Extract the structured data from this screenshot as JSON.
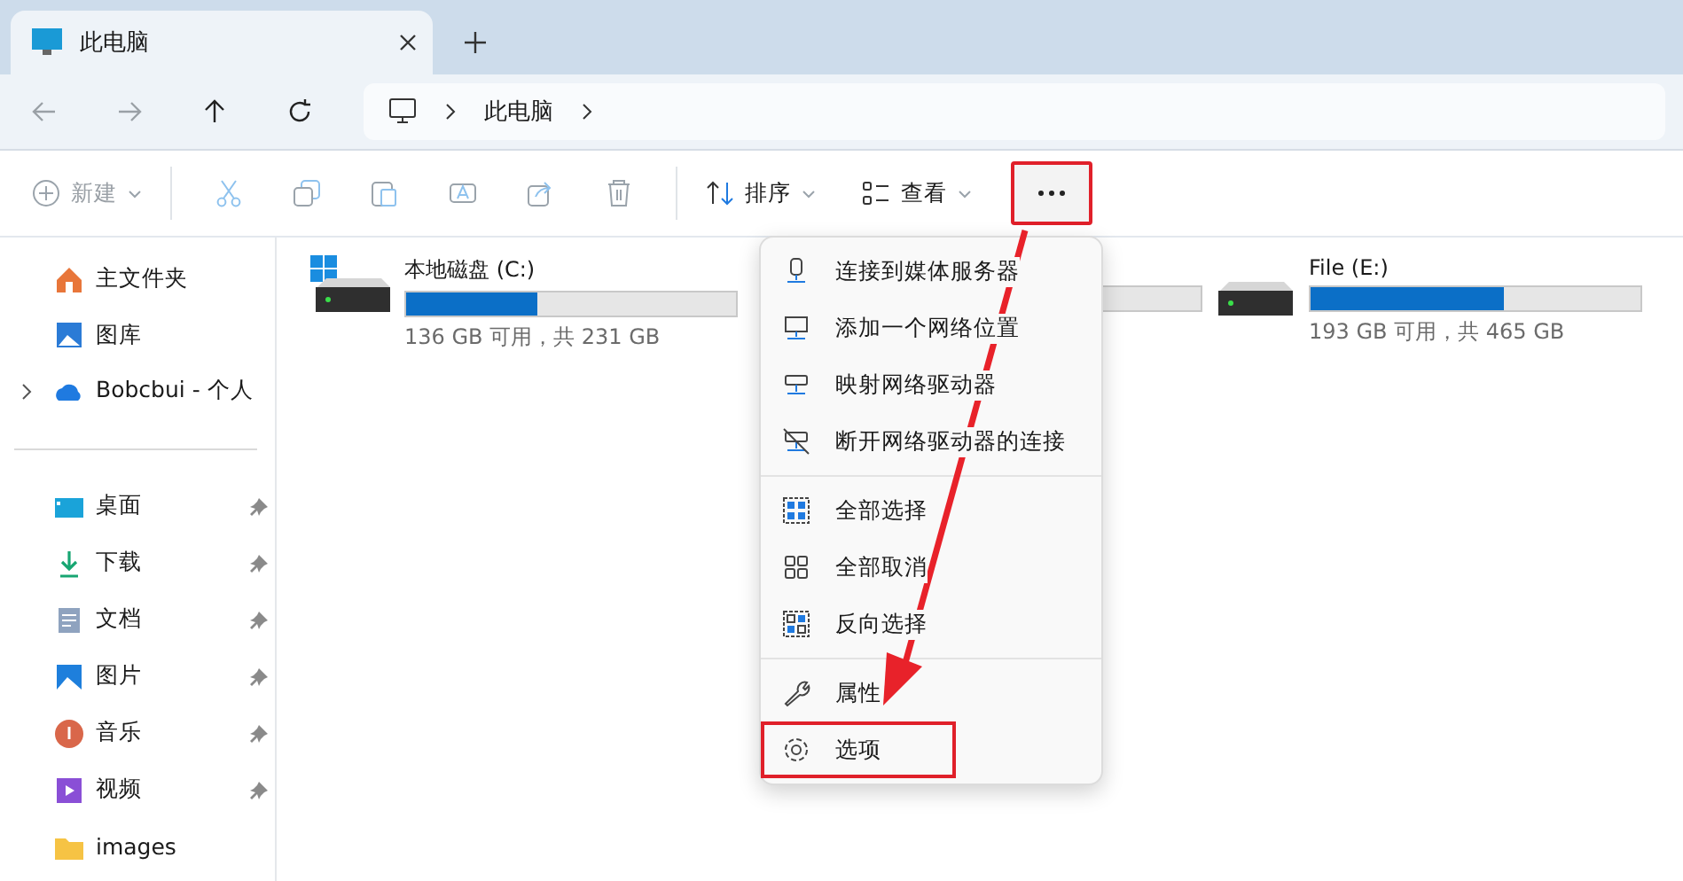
{
  "tab": {
    "title": "此电脑",
    "selected": true
  },
  "breadcrumb": [
    "此电脑"
  ],
  "toolbar": {
    "new_label": "新建",
    "sort_label": "排序",
    "view_label": "查看"
  },
  "sidebar": {
    "top": [
      {
        "label": "主文件夹",
        "expandable": false
      },
      {
        "label": "图库",
        "expandable": false
      },
      {
        "label": "Bobcbui - 个人",
        "expandable": true
      }
    ],
    "quick": [
      {
        "label": "桌面",
        "pinned": true
      },
      {
        "label": "下载",
        "pinned": true
      },
      {
        "label": "文档",
        "pinned": true
      },
      {
        "label": "图片",
        "pinned": true
      },
      {
        "label": "音乐",
        "pinned": true
      },
      {
        "label": "视频",
        "pinned": true
      },
      {
        "label": "images",
        "pinned": false
      }
    ]
  },
  "drives": [
    {
      "name": "本地磁盘 (C:)",
      "system": true,
      "level": 0.4,
      "space": "136 GB 可用，共 231 GB"
    },
    {
      "name": "File (E:)",
      "system": false,
      "level": 0.585,
      "space": "193 GB 可用，共 465 GB"
    }
  ],
  "menu": [
    [
      {
        "label": "连接到媒体服务器"
      },
      {
        "label": "添加一个网络位置"
      },
      {
        "label": "映射网络驱动器"
      },
      {
        "label": "断开网络驱动器的连接"
      }
    ],
    [
      {
        "label": "全部选择"
      },
      {
        "label": "全部取消"
      },
      {
        "label": "反向选择"
      }
    ],
    [
      {
        "label": "属性"
      },
      {
        "label": "选项"
      }
    ]
  ]
}
